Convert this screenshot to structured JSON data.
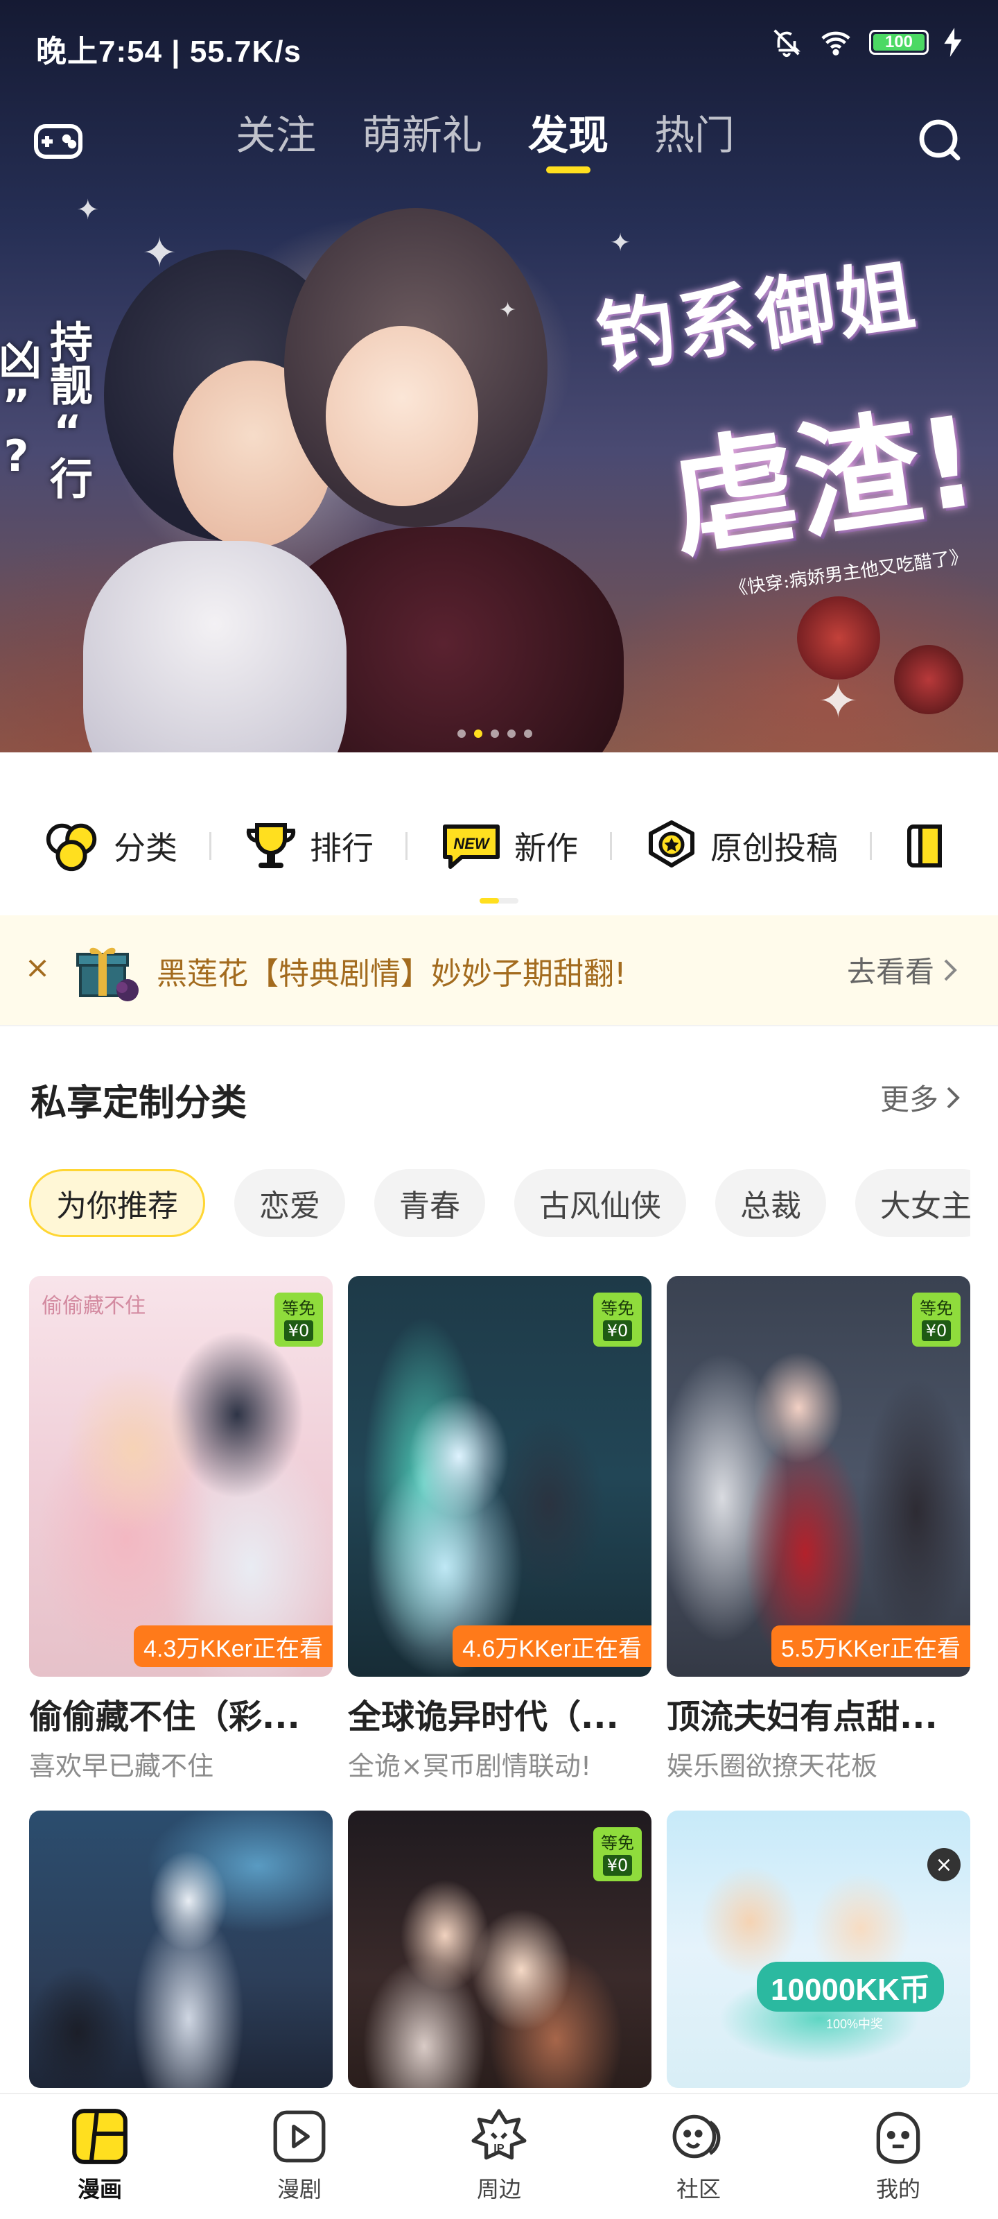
{
  "status_bar": {
    "time_speed": "晚上7:54 | 55.7K/s",
    "battery": "100"
  },
  "top_nav": {
    "tabs": [
      {
        "label": "关注"
      },
      {
        "label": "萌新礼"
      },
      {
        "label": "发现"
      },
      {
        "label": "热门"
      }
    ],
    "active_tab": "发现",
    "left_icon": "gamepad-icon",
    "right_icon": "search-icon"
  },
  "banner": {
    "side_text": "持靓“行凶”?",
    "headline_1": "钓系御姐",
    "headline_2": "虐渣!",
    "subtitle": "《快穿:病娇男主他又吃醋了》",
    "slide_count": 5,
    "active_slide": 2
  },
  "quick_categories": [
    {
      "label": "分类",
      "icon": "circles-icon"
    },
    {
      "label": "排行",
      "icon": "trophy-icon"
    },
    {
      "label": "新作",
      "icon": "new-badge-icon"
    },
    {
      "label": "原创投稿",
      "icon": "medal-icon"
    }
  ],
  "notice": {
    "text": "黑莲花【特典剧情】妙妙子期甜翻!",
    "action": "去看看",
    "icon": "gift-box-icon"
  },
  "section": {
    "title": "私享定制分类",
    "more": "更多"
  },
  "chips": [
    "为你推荐",
    "恋爱",
    "青春",
    "古风仙侠",
    "总裁",
    "大女主"
  ],
  "cards": [
    {
      "title": "偷偷藏不住（彩...",
      "subtitle": "喜欢早已藏不住",
      "watching": "4.3万KKer正在看",
      "free_label": "等免",
      "price": "¥0",
      "cover_text": "偷偷藏不住"
    },
    {
      "title": "全球诡异时代（...",
      "subtitle": "全诡×冥币剧情联动!",
      "watching": "4.6万KKer正在看",
      "free_label": "等免",
      "price": "¥0"
    },
    {
      "title": "顶流夫妇有点甜...",
      "subtitle": "娱乐圈欲撩天花板",
      "watching": "5.5万KKer正在看",
      "free_label": "等免",
      "price": "¥0"
    }
  ],
  "cards_row2": [
    {
      "free": false
    },
    {
      "free_label": "等免",
      "price": "¥0"
    },
    {
      "ad_text": "10000KK币",
      "ad_subtext": "100%中奖",
      "close": "×"
    }
  ],
  "bottom_nav": [
    {
      "label": "漫画",
      "icon": "comic-icon"
    },
    {
      "label": "漫剧",
      "icon": "play-icon"
    },
    {
      "label": "周边",
      "icon": "ip-icon"
    },
    {
      "label": "社区",
      "icon": "community-icon"
    },
    {
      "label": "我的",
      "icon": "profile-icon"
    }
  ],
  "colors": {
    "accent": "#ffdf1f",
    "notice_text": "#a36b1e",
    "watch_badge": "#ff7a1a",
    "free_badge": "#8fdc3c"
  }
}
